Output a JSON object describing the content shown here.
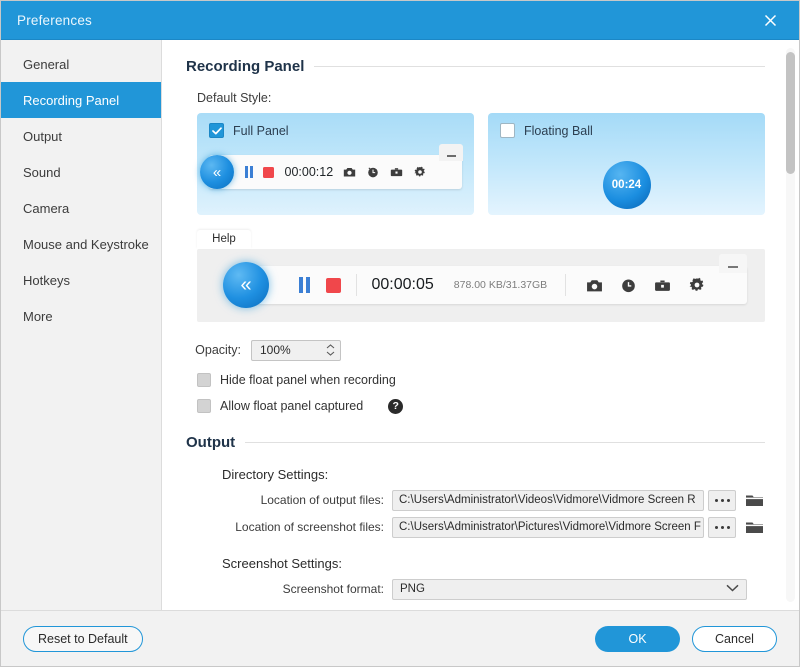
{
  "window": {
    "title": "Preferences",
    "close_icon": "close-icon",
    "accent_color": "#2196d8"
  },
  "sidebar": {
    "items": [
      {
        "label": "General",
        "active": false
      },
      {
        "label": "Recording Panel",
        "active": true
      },
      {
        "label": "Output",
        "active": false
      },
      {
        "label": "Sound",
        "active": false
      },
      {
        "label": "Camera",
        "active": false
      },
      {
        "label": "Mouse and Keystroke",
        "active": false
      },
      {
        "label": "Hotkeys",
        "active": false
      },
      {
        "label": "More",
        "active": false
      }
    ]
  },
  "recording_panel": {
    "section_title": "Recording Panel",
    "default_style_label": "Default Style:",
    "full_panel": {
      "label": "Full Panel",
      "checked": true,
      "timer": "00:00:12",
      "icons": [
        "camera-icon",
        "clock-icon",
        "toolbox-icon",
        "gear-icon"
      ]
    },
    "floating_ball": {
      "label": "Floating Ball",
      "checked": false,
      "timer": "00:24"
    },
    "preview": {
      "help_tab": "Help",
      "timer": "00:00:05",
      "size_text": "878.00 KB/31.37GB",
      "icons": [
        "camera-icon",
        "clock-icon",
        "toolbox-icon",
        "gear-icon"
      ]
    },
    "opacity": {
      "label": "Opacity:",
      "value": "100%"
    },
    "hide_float_panel": {
      "label": "Hide float panel when recording",
      "checked": false
    },
    "allow_float_captured": {
      "label": "Allow float panel captured",
      "checked": false,
      "help_glyph": "?"
    }
  },
  "output": {
    "section_title": "Output",
    "directory_settings_label": "Directory Settings:",
    "output_files": {
      "label": "Location of output files:",
      "value": "C:\\Users\\Administrator\\Videos\\Vidmore\\Vidmore Screen R"
    },
    "screenshot_files": {
      "label": "Location of screenshot files:",
      "value": "C:\\Users\\Administrator\\Pictures\\Vidmore\\Vidmore Screen F"
    },
    "screenshot_settings_label": "Screenshot Settings:",
    "screenshot_format": {
      "label": "Screenshot format:",
      "value": "PNG"
    }
  },
  "footer": {
    "reset_label": "Reset to Default",
    "ok_label": "OK",
    "cancel_label": "Cancel"
  }
}
